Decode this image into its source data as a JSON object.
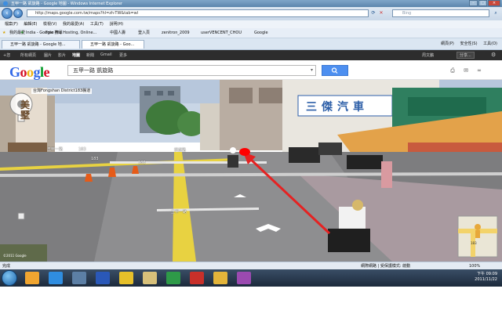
{
  "window": {
    "title": "五甲一路 凱旋路 - Google 地圖 - Windows Internet Explorer"
  },
  "address_bar": {
    "url": "http://maps.google.com.tw/maps?hl=zh-TW&tab=wl",
    "search_placeholder": "Bing"
  },
  "menu": [
    "檔案(F)",
    "編輯(E)",
    "檢視(V)",
    "我的最愛(A)",
    "工具(T)",
    "說明(H)"
  ],
  "favorites": {
    "label": "我的最愛",
    "items": [
      "India - Google 搜尋",
      "Free File Hosting, Online...",
      "中國人壽",
      "登入頁",
      "zenitron_2009",
      "userVENCENT_CHOU",
      "Google"
    ]
  },
  "tabs": [
    "五甲一路 凱旋路 - Google 地...",
    "五甲一路 凱旋路 - Goo..."
  ],
  "command_bar": [
    "網頁(P)",
    "安全性(S)",
    "工具(O)"
  ],
  "google_bar": {
    "items": [
      "+您",
      "所有網頁",
      "圖片",
      "影片",
      "地圖",
      "新聞",
      "Gmail",
      "更多"
    ],
    "user": "周文鵬",
    "share": "分享..."
  },
  "maps_header": {
    "logo": "Google",
    "query": "五甲一路 凱旋路"
  },
  "streetview": {
    "location_label": "台灣Fongshan District183縣道",
    "road_labels": [
      "五甲一路",
      "凱旋路",
      "五甲一路",
      "183",
      "183",
      "183"
    ],
    "sign_text": "三傑汽車",
    "shop_text": "美墅",
    "copyright": "©2011 Google",
    "minimap_label": "183",
    "marker_color": "#ff0000"
  },
  "status": {
    "left": "完成",
    "zone": "網際網路 | 受保護模式: 啟動",
    "zoom": "100%"
  },
  "taskbar": {
    "time": "下午 09:09",
    "date": "2011/11/22"
  },
  "colors": {
    "arrow": "#e52222",
    "search_button": "#4d8ff0"
  }
}
